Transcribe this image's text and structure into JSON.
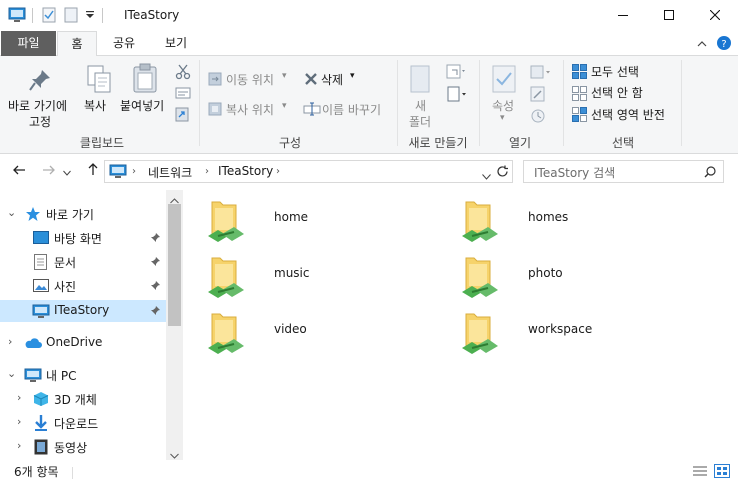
{
  "window": {
    "title": "ITeaStory"
  },
  "ribbon_tabs": {
    "file": "파일",
    "home": "홈",
    "share": "공유",
    "view": "보기"
  },
  "clipboard": {
    "pin_quick_line1": "바로 가기에",
    "pin_quick_line2": "고정",
    "copy": "복사",
    "paste": "붙여넣기",
    "label": "클립보드"
  },
  "organize": {
    "move_to": "이동 위치",
    "copy_to": "복사 위치",
    "delete": "삭제",
    "rename": "이름 바꾸기",
    "label": "구성"
  },
  "new": {
    "new_folder_line1": "새",
    "new_folder_line2": "폴더",
    "label": "새로 만들기"
  },
  "open": {
    "properties": "속성",
    "label": "열기"
  },
  "select": {
    "select_all": "모두 선택",
    "select_none": "선택 안 함",
    "invert": "선택 영역 반전",
    "label": "선택"
  },
  "address": {
    "network": "네트워크",
    "current": "ITeaStory"
  },
  "search": {
    "placeholder": "ITeaStory 검색"
  },
  "navpane": {
    "quick_access": "바로 가기",
    "items": [
      "바탕 화면",
      "문서",
      "사진",
      "ITeaStory"
    ],
    "onedrive": "OneDrive",
    "thispc": "내 PC",
    "pc_items": [
      "3D 개체",
      "다운로드",
      "동영상"
    ]
  },
  "folders": [
    "home",
    "homes",
    "music",
    "photo",
    "video",
    "workspace"
  ],
  "status": {
    "count": "6개 항목"
  },
  "colors": {
    "accent": "#0078d7",
    "selection": "#cce8ff",
    "folder": "#f6d36b",
    "share": "#4caf50"
  }
}
